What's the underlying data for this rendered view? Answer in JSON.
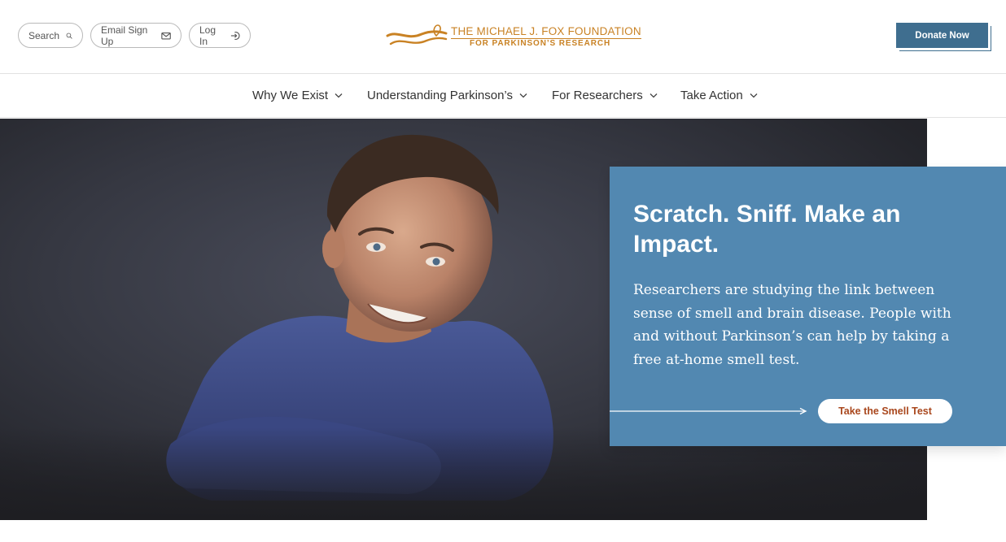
{
  "header": {
    "search_label": "Search",
    "email_label": "Email Sign Up",
    "login_label": "Log In",
    "logo_line1": "THE MICHAEL J. FOX FOUNDATION",
    "logo_line2": "FOR PARKINSON’S RESEARCH",
    "donate_label": "Donate Now",
    "icons": [
      "search-icon",
      "envelope-icon",
      "login-icon"
    ]
  },
  "nav": {
    "items": [
      {
        "label": "Why We Exist"
      },
      {
        "label": "Understanding Parkinson’s"
      },
      {
        "label": "For Researchers"
      },
      {
        "label": "Take Action"
      }
    ]
  },
  "hero": {
    "heading": "Scratch. Sniff. Make an Impact.",
    "body": "Researchers are studying the link between sense of smell and brain disease. People with and without Parkinson’s can help by taking a free at-home smell test.",
    "cta_label": "Take the Smell Test"
  },
  "colors": {
    "brand_orange": "#c98224",
    "brand_blue": "#3f6e8f",
    "card_blue": "#5288b1",
    "cta_text": "#a9471d"
  }
}
